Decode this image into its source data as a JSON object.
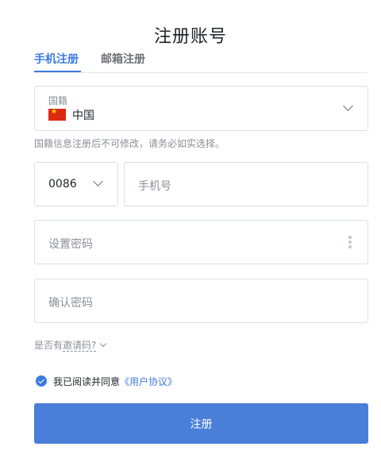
{
  "page": {
    "title": "注册账号"
  },
  "tabs": [
    {
      "label": "手机注册",
      "active": true
    },
    {
      "label": "邮箱注册",
      "active": false
    }
  ],
  "nationality": {
    "label": "国籍",
    "value": "中国",
    "flag_icon": "china-flag-icon",
    "hint": "国籍信息注册后不可修改，请务必如实选择。"
  },
  "phone": {
    "country_code": "0086",
    "placeholder": "手机号"
  },
  "password": {
    "placeholder": "设置密码"
  },
  "confirm_password": {
    "placeholder": "确认密码"
  },
  "invite": {
    "prefix": "是否有",
    "link": "邀请码?"
  },
  "agreement": {
    "checked": true,
    "text": "我已阅读并同意",
    "link": "《用户协议》"
  },
  "submit_label": "注册",
  "colors": {
    "accent": "#3d7be0",
    "button": "#4a7fd9",
    "border": "#dcdfe3",
    "muted_text": "#8a9099"
  }
}
